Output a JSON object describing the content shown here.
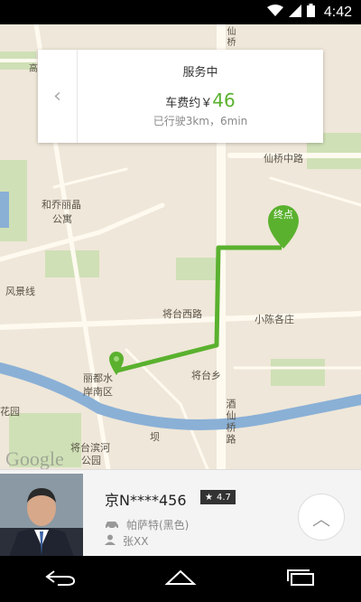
{
  "status_bar": {
    "time": "4:42"
  },
  "status_card": {
    "title": "服务中",
    "fare_prefix": "车费约￥",
    "fare_amount": "46",
    "trip_info": "已行驶3km，6min"
  },
  "map": {
    "labels": [
      "仙桥中路",
      "和乔丽晶",
      "公寓",
      "风景线",
      "将台西路",
      "小陈各庄",
      "丽都水",
      "岸南区",
      "将台乡",
      "花园",
      "将台滨河",
      "公园",
      "酒仙桥路",
      "仙桥",
      "高家园小区",
      "坝"
    ],
    "watermark": "Google",
    "destination_badge": "终点"
  },
  "driver": {
    "plate": "京N****456",
    "rating": "4.7",
    "car": "帕萨特(黑色)",
    "name": "张XX"
  },
  "colors": {
    "route": "#5ab12e",
    "accent": "#5ab12e",
    "river": "#8ab0d6"
  }
}
